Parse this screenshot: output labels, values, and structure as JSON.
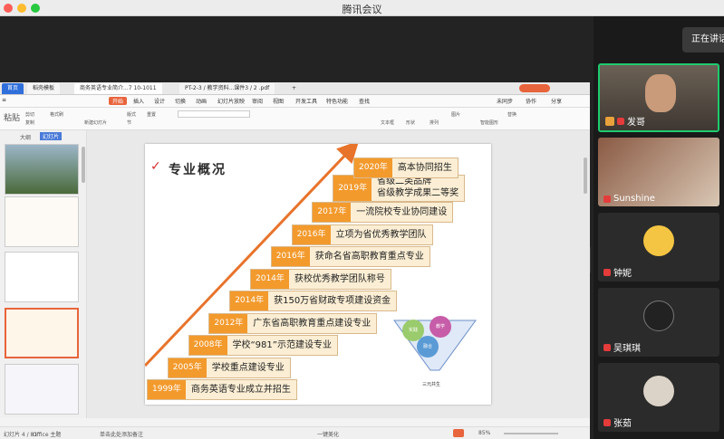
{
  "window": {
    "title": "腾讯会议"
  },
  "speaking": {
    "label": "正在讲话"
  },
  "participants": [
    {
      "name": "发哥"
    },
    {
      "name": "Sunshine"
    },
    {
      "name": "钟妮"
    },
    {
      "name": "吴琪琪"
    },
    {
      "name": "张茹"
    }
  ],
  "wps": {
    "tabs": [
      "首页",
      "稻壳模板",
      "商务英语专业简介...7 10-1011",
      "PT-2-3 / 教学资料...课件3 / 2 .pdf"
    ],
    "ribbon_tabs": [
      "开始",
      "插入",
      "设计",
      "切换",
      "动画",
      "幻灯片放映",
      "审阅",
      "视图",
      "开发工具",
      "特色功能",
      "查找"
    ],
    "ribbon_right": [
      "未同步",
      "协作",
      "分享"
    ],
    "ribbon_items": [
      "粘贴",
      "剪切",
      "复制",
      "格式刷",
      "新建幻灯片",
      "版式",
      "节",
      "重置",
      "文本框",
      "形状",
      "排列",
      "图片",
      "替换",
      "智能图形"
    ],
    "panel_tabs": [
      "大纲",
      "幻灯片"
    ],
    "statusbar": {
      "page": "幻灯片 4 / 81",
      "theme": "Office 主题",
      "notes": "单击此处添加备注",
      "zoom": "85%",
      "protect": "一键美化"
    }
  },
  "slide": {
    "heading": "专业概况",
    "steps": [
      {
        "year": "1999年",
        "text": "商务英语专业成立并招生"
      },
      {
        "year": "2005年",
        "text": "学校重点建设专业"
      },
      {
        "year": "2008年",
        "text": "学校“981”示范建设专业"
      },
      {
        "year": "2012年",
        "text": "广东省高职教育重点建设专业"
      },
      {
        "year": "2014年",
        "text": "获150万省财政专项建设资金"
      },
      {
        "year": "2014年",
        "text": "获校优秀教学团队称号"
      },
      {
        "year": "2016年",
        "text": "获命名省高职教育重点专业"
      },
      {
        "year": "2016年",
        "text": "立项为省优秀教学团队"
      },
      {
        "year": "2017年",
        "text": "一流院校专业协同建设"
      },
      {
        "year": "2019年",
        "text": "省级二类品牌\n省级教学成果二等奖"
      },
      {
        "year": "2020年",
        "text": "高本协同招生"
      }
    ],
    "funnel_labels": [
      "实践",
      "教学",
      "融合",
      "三元共生"
    ]
  },
  "colors": {
    "accent": "#e8643c",
    "step_year": "#f39a2d",
    "active_border": "#1ecb6e"
  }
}
